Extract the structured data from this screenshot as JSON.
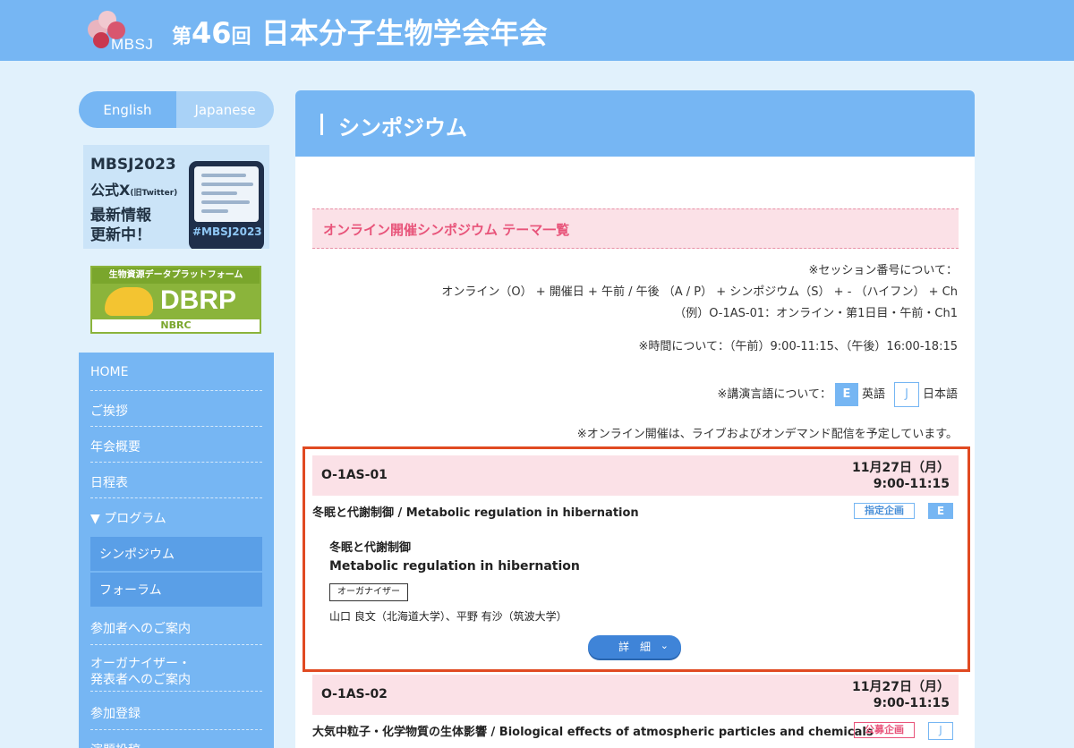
{
  "header": {
    "logo_text": "MBSJ",
    "title_prefix": "第",
    "title_number": "46",
    "title_kai": "回",
    "title_main": "日本分子生物学会年会"
  },
  "sidebar": {
    "lang_en": "English",
    "lang_ja": "Japanese",
    "banner_twitter": {
      "line1": "MBSJ2023",
      "line2": "公式X",
      "line2_small": "(旧Twitter)",
      "line3": "最新情報",
      "line4": "更新中！",
      "hashtag": "#MBSJ2023"
    },
    "banner_dbrp": {
      "top": "生物資源データプラットフォーム",
      "logo": "DBRP",
      "bottom": "NBRC"
    },
    "nav": [
      {
        "label": "HOME"
      },
      {
        "label": "ご挨拶"
      },
      {
        "label": "年会概要"
      },
      {
        "label": "日程表"
      },
      {
        "label": "▼ プログラム"
      },
      {
        "label": "シンポジウム"
      },
      {
        "label": "フォーラム"
      },
      {
        "label": "参加者へのご案内"
      },
      {
        "label": "オーガナイザー・"
      },
      {
        "label": "発表者へのご案内"
      },
      {
        "label": "参加登録"
      },
      {
        "label": "演題投稿"
      }
    ]
  },
  "main": {
    "page_title": "シンポジウム",
    "section_title": "オンライン開催シンポジウム テーマ一覧",
    "notes": {
      "session_label": "※セッション番号について：",
      "session_format": "オンライン（O） + 開催日 + 午前 / 午後 （A / P） + シンポジウム（S） + - （ハイフン） + Ch",
      "session_example": "（例）O-1AS-01：オンライン・第1日目・午前・Ch1",
      "time": "※時間について：（午前）9:00-11:15、（午後）16:00-18:15",
      "lang_label": "※講演言語について：",
      "lang_e": "E",
      "lang_e_text": "英語",
      "lang_j": "J",
      "lang_j_text": "日本語",
      "online": "※オンライン開催は、ライブおよびオンデマンド配信を予定しています。"
    },
    "sessions": [
      {
        "code": "O-1AS-01",
        "date": "11月27日（月）",
        "time": "9:00-11:15",
        "title": "冬眠と代謝制御 / Metabolic regulation in hibernation",
        "category": "指定企画",
        "language": "E",
        "title_ja": "冬眠と代謝制御",
        "title_en": "Metabolic regulation in hibernation",
        "organizer_label": "オーガナイザー",
        "organizers": "山口 良文（北海道大学）、平野 有沙（筑波大学）",
        "detail_button": "詳　細",
        "chevron": "⌄"
      },
      {
        "code": "O-1AS-02",
        "date": "11月27日（月）",
        "time": "9:00-11:15",
        "title": "大気中粒子・化学物質の生体影響 / Biological effects of atmospheric particles and chemicals",
        "category": "公募企画",
        "language": "J"
      }
    ]
  }
}
